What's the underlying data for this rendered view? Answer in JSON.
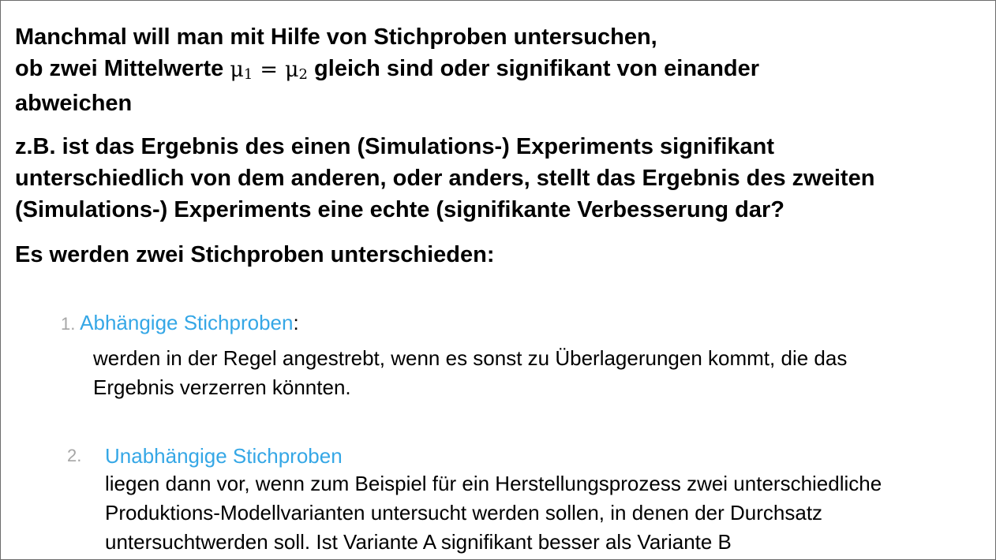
{
  "intro": {
    "line1": "Manchmal will man mit Hilfe von Stichproben untersuchen,",
    "line2_before": "ob zwei Mittelwerte",
    "mu": "μ",
    "sub1": "1",
    "eq": "=",
    "sub2": "2",
    "line2_after": "gleich sind oder signifikant von einander",
    "line3": "abweichen"
  },
  "example": {
    "line1": "z.B. ist das Ergebnis des einen (Simulations-) Experiments signifikant",
    "line2": "unterschiedlich von dem anderen, oder anders, stellt das Ergebnis des zweiten",
    "line3": "(Simulations-) Experiments eine echte (signifikante Verbesserung dar?"
  },
  "types_heading": "Es werden zwei Stichproben unterschieden:",
  "items": [
    {
      "number": "1.",
      "title": "Abhängige Stichproben",
      "title_suffix": ":",
      "body": [
        "werden in der Regel angestrebt, wenn es sonst zu Überlagerungen kommt, die das",
        "Ergebnis verzerren könnten."
      ]
    },
    {
      "number": "2.",
      "title": "Unabhängige Stichproben",
      "body": [
        "liegen dann vor, wenn zum Beispiel für ein Herstellungsprozess zwei unterschiedliche",
        "Produktions-Modellvarianten untersucht werden sollen, in denen der Durchsatz",
        "untersuchtwerden soll. Ist Variante A signifikant besser als Variante B"
      ]
    }
  ],
  "colors": {
    "accent_link": "#35a7e6",
    "number_gray": "#a6a6a6",
    "border": "#6d6d6d"
  }
}
